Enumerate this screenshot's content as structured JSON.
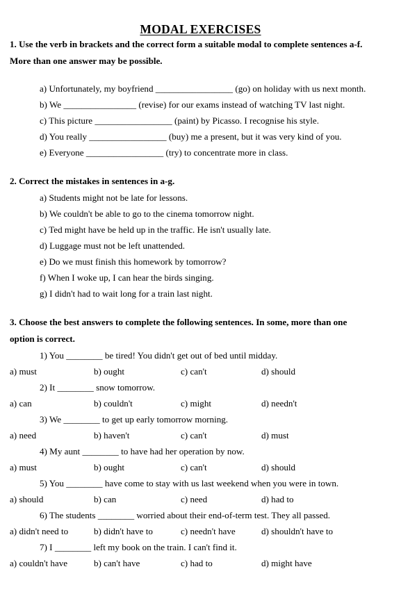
{
  "document": {
    "title": "MODAL EXERCISES"
  },
  "sections": [
    {
      "id": "section-1",
      "heading_line_1": "1. Use the verb in brackets and the correct form a suitable modal to complete sentences a-f.",
      "heading_line_2": "More than one answer may be possible.",
      "items": [
        "a) Unfortunately, my boyfriend _________________ (go) on holiday with us next month.",
        "b) We ________________ (revise) for our exams instead of watching TV last night.",
        "c) This picture _________________ (paint) by Picasso. I recognise his style.",
        "d) You really _________________ (buy) me a present, but it was very kind of you.",
        "e) Everyone _________________ (try) to concentrate more in class."
      ]
    },
    {
      "id": "section-2",
      "heading_line_1": "2. Correct the mistakes in sentences in a-g.",
      "items": [
        "a) Students might not be late for lessons.",
        "b) We couldn't be able to go to the cinema tomorrow night.",
        "c) Ted might have be held up in the traffic. He isn't usually late.",
        "d) Luggage must not be left unattended.",
        "e) Do we must finish this homework by tomorrow?",
        "f) When I woke up, I can hear the birds singing.",
        "g) I didn't had to wait long for a train last night."
      ]
    },
    {
      "id": "section-3",
      "heading_line_1": "3. Choose the best answers to complete the following sentences. In some, more than one",
      "heading_line_2": "option is correct.",
      "questions": [
        {
          "prompt": "1) You ________ be tired! You didn't get out of bed until midday.",
          "options": [
            "a) must",
            "b) ought",
            "c) can't",
            "d) should"
          ]
        },
        {
          "prompt": "2) It ________ snow tomorrow.",
          "options": [
            "a) can",
            "b) couldn't",
            "c) might",
            "d) needn't"
          ]
        },
        {
          "prompt": "3) We ________ to get up early tomorrow morning.",
          "options": [
            "a) need",
            "b) haven't",
            "c) can't",
            "d) must"
          ]
        },
        {
          "prompt": "4) My aunt ________ to have had her operation by now.",
          "options": [
            "a) must",
            "b) ought",
            "c) can't",
            "d) should"
          ]
        },
        {
          "prompt": "5) You ________ have come to stay with us last weekend when you were in town.",
          "options": [
            "a) should",
            "b) can",
            "c) need",
            "d) had to"
          ]
        },
        {
          "prompt": "6) The students ________ worried about their end-of-term test. They all passed.",
          "options": [
            "a) didn't need to",
            "b) didn't have to",
            "c) needn't have",
            "d) shouldn't have to"
          ]
        },
        {
          "prompt": "7) I ________ left my book on the train. I can't find it.",
          "options": [
            "a) couldn't have",
            "b) can't have",
            "c) had to",
            "d)  might have"
          ]
        }
      ]
    }
  ]
}
